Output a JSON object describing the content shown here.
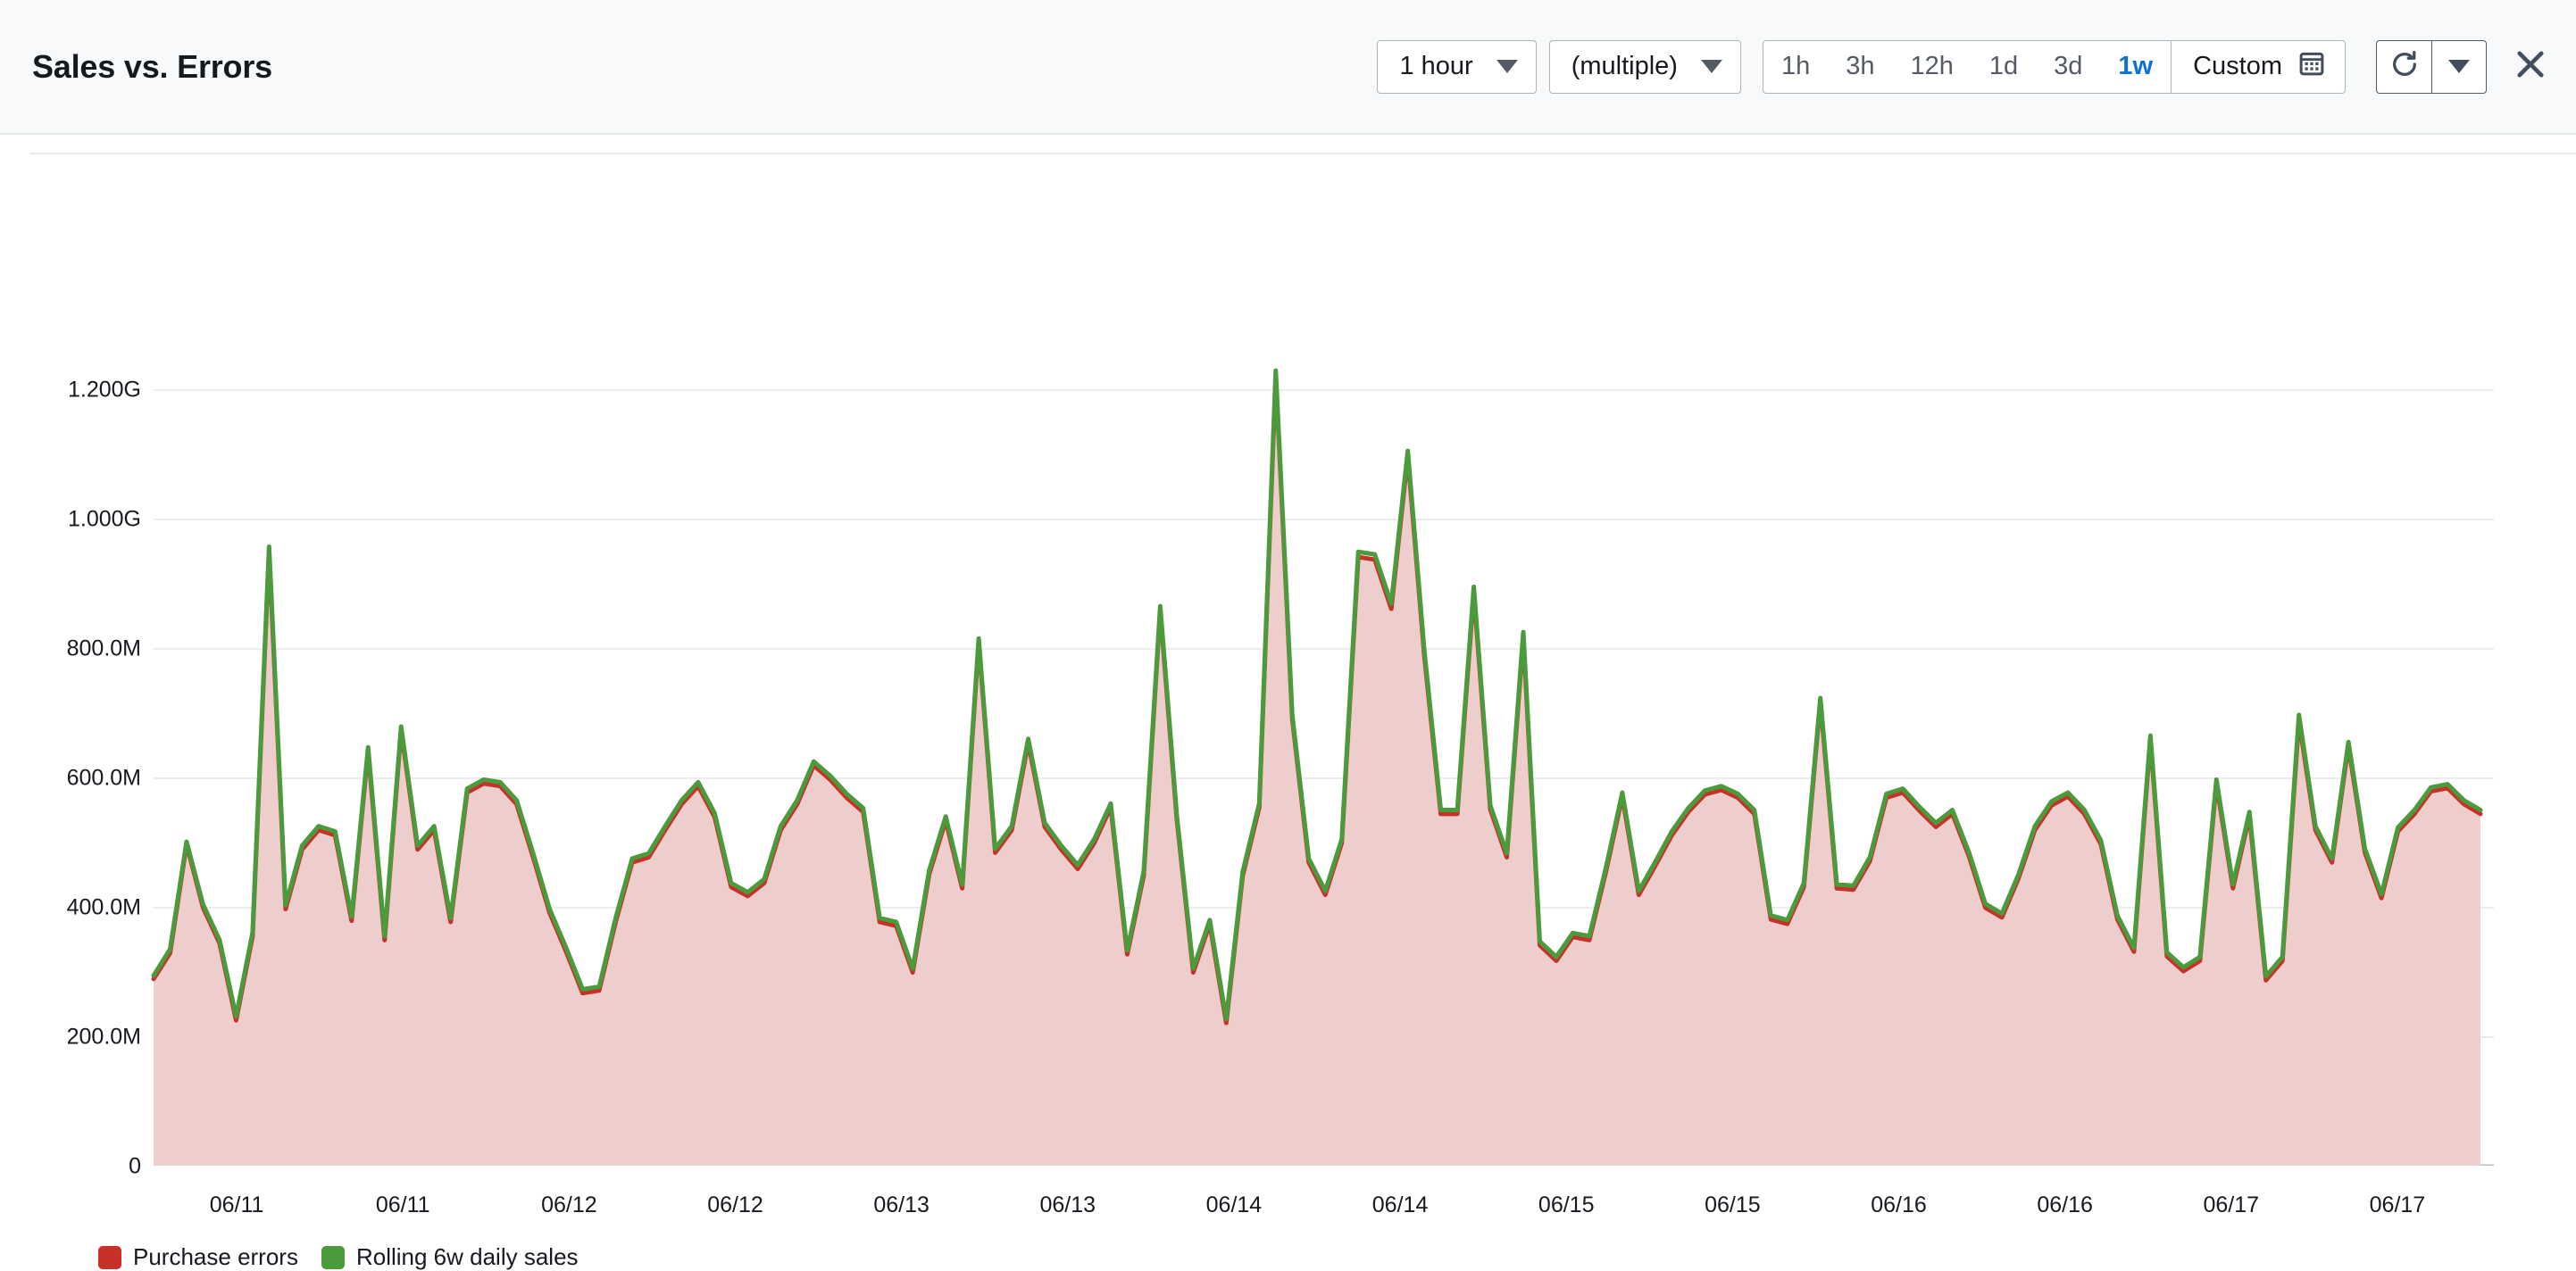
{
  "header": {
    "title": "Sales vs. Errors",
    "period_dropdown": {
      "label": "1 hour",
      "icon": "chevron-down-icon"
    },
    "metrics_dropdown": {
      "label": "(multiple)",
      "icon": "chevron-down-icon"
    },
    "range_options": [
      {
        "label": "1h",
        "active": false
      },
      {
        "label": "3h",
        "active": false
      },
      {
        "label": "12h",
        "active": false
      },
      {
        "label": "1d",
        "active": false
      },
      {
        "label": "3d",
        "active": false
      },
      {
        "label": "1w",
        "active": true
      }
    ],
    "custom_label": "Custom",
    "custom_icon": "calendar-icon",
    "refresh_icon": "refresh-icon",
    "refresh_dropdown_icon": "chevron-down-icon",
    "close_icon": "close-icon",
    "accent_color": "#0972d3",
    "border_color": "#aab7b8"
  },
  "chart_data": {
    "type": "area",
    "title": "Sales vs. Errors",
    "xlabel": "",
    "ylabel": "",
    "grid": true,
    "legend_position": "bottom-left",
    "ylim": [
      0,
      1300000000
    ],
    "ytick_values": [
      0,
      200000000,
      400000000,
      600000000,
      800000000,
      1000000000,
      1200000000
    ],
    "ytick_labels": [
      "0",
      "200.0M",
      "400.0M",
      "600.0M",
      "800.0M",
      "1.000G",
      "1.200G"
    ],
    "xtick_labels": [
      "06/11",
      "06/11",
      "06/12",
      "06/12",
      "06/13",
      "06/13",
      "06/14",
      "06/14",
      "06/15",
      "06/15",
      "06/16",
      "06/16",
      "06/17",
      "06/17"
    ],
    "x_start": "06/10 12:00",
    "x_end": "06/17 12:00",
    "series": [
      {
        "name": "Purchase errors",
        "color": "#c7312a",
        "fill_color": "#eecdcd",
        "values": [
          290,
          330,
          498,
          400,
          345,
          226,
          356,
          950,
          398,
          490,
          520,
          512,
          380,
          642,
          350,
          675,
          490,
          520,
          378,
          578,
          592,
          588,
          560,
          478,
          392,
          332,
          268,
          272,
          378,
          470,
          478,
          520,
          560,
          588,
          540,
          432,
          418,
          438,
          520,
          560,
          620,
          598,
          570,
          548,
          378,
          372,
          300,
          452,
          535,
          430,
          810,
          485,
          520,
          655,
          525,
          490,
          460,
          500,
          555,
          328,
          450,
          860,
          538,
          300,
          375,
          222,
          450,
          555,
          1222,
          692,
          470,
          420,
          500,
          942,
          938,
          862,
          1098,
          790,
          545,
          545,
          888,
          552,
          478,
          818,
          342,
          318,
          355,
          350,
          455,
          572,
          420,
          465,
          512,
          548,
          575,
          582,
          570,
          545,
          382,
          375,
          432,
          718,
          430,
          428,
          472,
          570,
          578,
          550,
          525,
          545,
          480,
          400,
          385,
          445,
          520,
          558,
          572,
          545,
          498,
          382,
          332,
          660,
          325,
          302,
          318,
          592,
          430,
          542,
          288,
          318,
          690,
          520,
          470,
          650,
          485,
          415,
          518,
          545,
          580,
          585,
          560,
          545
        ]
      },
      {
        "name": "Rolling 6w daily sales",
        "color": "#4b9b3d",
        "values": [
          295,
          336,
          502,
          405,
          350,
          232,
          362,
          958,
          404,
          496,
          526,
          518,
          386,
          648,
          356,
          680,
          496,
          526,
          384,
          584,
          598,
          594,
          566,
          484,
          398,
          338,
          274,
          278,
          384,
          476,
          484,
          526,
          566,
          594,
          546,
          438,
          424,
          444,
          526,
          566,
          626,
          604,
          576,
          554,
          384,
          378,
          306,
          458,
          541,
          436,
          816,
          491,
          526,
          661,
          531,
          496,
          466,
          506,
          561,
          334,
          456,
          866,
          544,
          306,
          381,
          228,
          456,
          561,
          1230,
          698,
          476,
          426,
          506,
          950,
          946,
          870,
          1106,
          798,
          551,
          551,
          896,
          558,
          484,
          826,
          348,
          324,
          361,
          356,
          461,
          578,
          426,
          471,
          518,
          554,
          581,
          588,
          576,
          551,
          388,
          381,
          438,
          724,
          436,
          434,
          478,
          576,
          584,
          556,
          531,
          551,
          486,
          406,
          391,
          451,
          526,
          564,
          578,
          551,
          504,
          388,
          338,
          666,
          331,
          308,
          324,
          598,
          436,
          548,
          294,
          324,
          698,
          526,
          476,
          656,
          491,
          421,
          524,
          551,
          586,
          591,
          566,
          551
        ]
      }
    ],
    "value_unit": "millions"
  },
  "legend": [
    {
      "label": "Purchase errors",
      "color": "#c7312a"
    },
    {
      "label": "Rolling 6w daily sales",
      "color": "#4b9b3d"
    }
  ]
}
